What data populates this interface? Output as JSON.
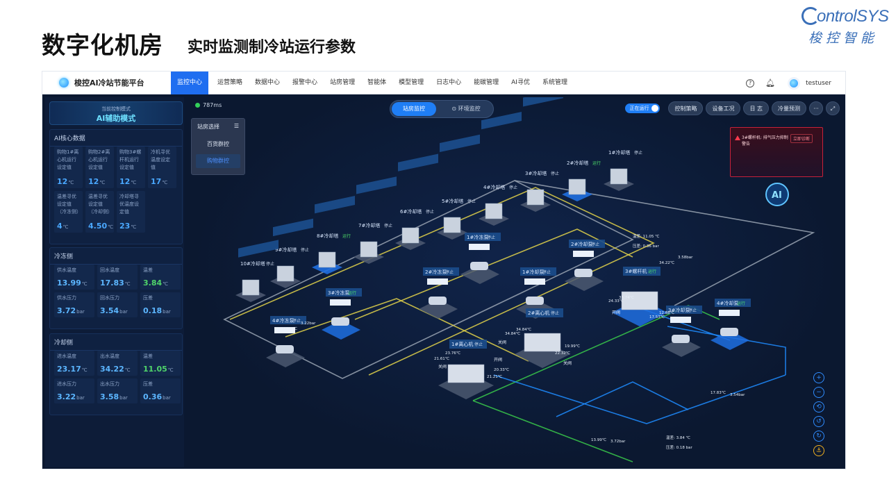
{
  "header": {
    "title": "数字化机房",
    "subtitle": "实时监测制冷站运行参数",
    "logo_en": "ontrolSYS",
    "logo_cn": "梭控智能"
  },
  "nav": {
    "brand": "梭控AI冷站节能平台",
    "items": [
      "监控中心",
      "运营策略",
      "数据中心",
      "报警中心",
      "站房管理",
      "智能体",
      "模型管理",
      "日志中心",
      "能碳管理",
      "AI寻优",
      "系统管理"
    ],
    "active": "监控中心",
    "user": "testuser"
  },
  "left": {
    "mode_label": "当前控制模式",
    "mode_value": "AI辅助模式",
    "core": {
      "title": "AI核心数据",
      "cards": [
        {
          "label": "购物1#离心机运行设定值",
          "value": "12",
          "unit": "℃"
        },
        {
          "label": "购物2#离心机运行设定值",
          "value": "12",
          "unit": "℃"
        },
        {
          "label": "购物3#螺杆机运行设定值",
          "value": "12",
          "unit": "℃"
        },
        {
          "label": "冷机寻优温度设定值",
          "value": "17",
          "unit": "℃"
        },
        {
          "label": "温差寻优设定值（冷冻侧）",
          "value": "4",
          "unit": "℃"
        },
        {
          "label": "温差寻优设定值（冷却侧）",
          "value": "4.50",
          "unit": "℃"
        },
        {
          "label": "冷却塔寻优温度设定值",
          "value": "23",
          "unit": "℃"
        }
      ]
    },
    "chilled": {
      "title": "冷冻侧",
      "cards": [
        {
          "label": "供水温度",
          "value": "13.99",
          "unit": "℃",
          "color": "b"
        },
        {
          "label": "回水温度",
          "value": "17.83",
          "unit": "℃",
          "color": "b"
        },
        {
          "label": "温差",
          "value": "3.84",
          "unit": "℃",
          "color": "g"
        },
        {
          "label": "供水压力",
          "value": "3.72",
          "unit": "bar",
          "color": "b"
        },
        {
          "label": "回水压力",
          "value": "3.54",
          "unit": "bar",
          "color": "b"
        },
        {
          "label": "压差",
          "value": "0.18",
          "unit": "bar",
          "color": "b"
        }
      ]
    },
    "cooling": {
      "title": "冷却侧",
      "cards": [
        {
          "label": "进水温度",
          "value": "23.17",
          "unit": "℃",
          "color": "b"
        },
        {
          "label": "出水温度",
          "value": "34.22",
          "unit": "℃",
          "color": "b"
        },
        {
          "label": "温差",
          "value": "11.05",
          "unit": "℃",
          "color": "g"
        },
        {
          "label": "进水压力",
          "value": "3.22",
          "unit": "bar",
          "color": "b"
        },
        {
          "label": "出水压力",
          "value": "3.58",
          "unit": "bar",
          "color": "b"
        },
        {
          "label": "压差",
          "value": "0.36",
          "unit": "bar",
          "color": "b"
        }
      ]
    }
  },
  "scene": {
    "ping": "787ms",
    "view_tabs": [
      "站房监控",
      "环境监控"
    ],
    "running": "正在运行",
    "buttons": [
      "控制策略",
      "设备工况",
      "日 志",
      "冷量预测",
      "···",
      "⤢"
    ],
    "station_select": {
      "title": "站房选择",
      "options": [
        "百货群控",
        "购物群控"
      ],
      "selected": "购物群控"
    },
    "alarm": {
      "text": "3#螺杆机: 排气压力抑制警告",
      "button": "立即诊断"
    },
    "towers": [
      {
        "name": "1#冷却塔",
        "status": "停止"
      },
      {
        "name": "2#冷却塔",
        "status": "运行"
      },
      {
        "name": "3#冷却塔",
        "status": "停止"
      },
      {
        "name": "4#冷却塔",
        "status": "停止"
      },
      {
        "name": "5#冷却塔",
        "status": "停止"
      },
      {
        "name": "6#冷却塔",
        "status": "停止"
      },
      {
        "name": "7#冷却塔",
        "status": "停止"
      },
      {
        "name": "8#冷却塔",
        "status": "运行"
      },
      {
        "name": "9#冷却塔",
        "status": "停止"
      },
      {
        "name": "10#冷却塔",
        "status": "停止"
      }
    ],
    "pumps": [
      {
        "name": "4#冷却泵",
        "status": "运行"
      },
      {
        "name": "3#冷却泵",
        "status": "停止"
      },
      {
        "name": "2#冷却泵",
        "status": "停止"
      },
      {
        "name": "1#冷却泵",
        "status": "停止"
      },
      {
        "name": "1#冷冻泵",
        "status": "停止"
      },
      {
        "name": "2#冷冻泵",
        "status": "停止"
      },
      {
        "name": "3#冷冻泵",
        "status": "运行"
      },
      {
        "name": "4#冷冻泵",
        "status": "停止"
      }
    ],
    "chillers": [
      {
        "name": "3#螺杆机",
        "status": "运行"
      },
      {
        "name": "2#离心机",
        "status": "停止"
      },
      {
        "name": "1#离心机",
        "status": "停止"
      }
    ],
    "readings": [
      "温差: 11.05 ℃",
      "压差: 0.36 bar",
      "温差: 3.84 ℃",
      "压差: 0.18 bar",
      "23.17℃",
      "3.22bar",
      "34.22℃",
      "3.58bar",
      "13.99℃",
      "3.72bar",
      "17.83℃",
      "3.54bar",
      "24.33℃",
      "35.74℃",
      "12.88℃",
      "17.53℃",
      "34.84℃",
      "34.84℃",
      "19.99℃",
      "22.32℃",
      "23.76℃",
      "21.61℃",
      "20.33℃",
      "21.21℃"
    ],
    "valve": [
      "开阀",
      "关阀"
    ]
  },
  "colors": {
    "accent": "#1f6ef0",
    "bg": "#0b1830",
    "cooling_pipe": "#e2d24a",
    "chilled_pipe": "#1f8cff",
    "return_pipe": "#39c94a",
    "grey_pipe": "#9aa4b3"
  }
}
